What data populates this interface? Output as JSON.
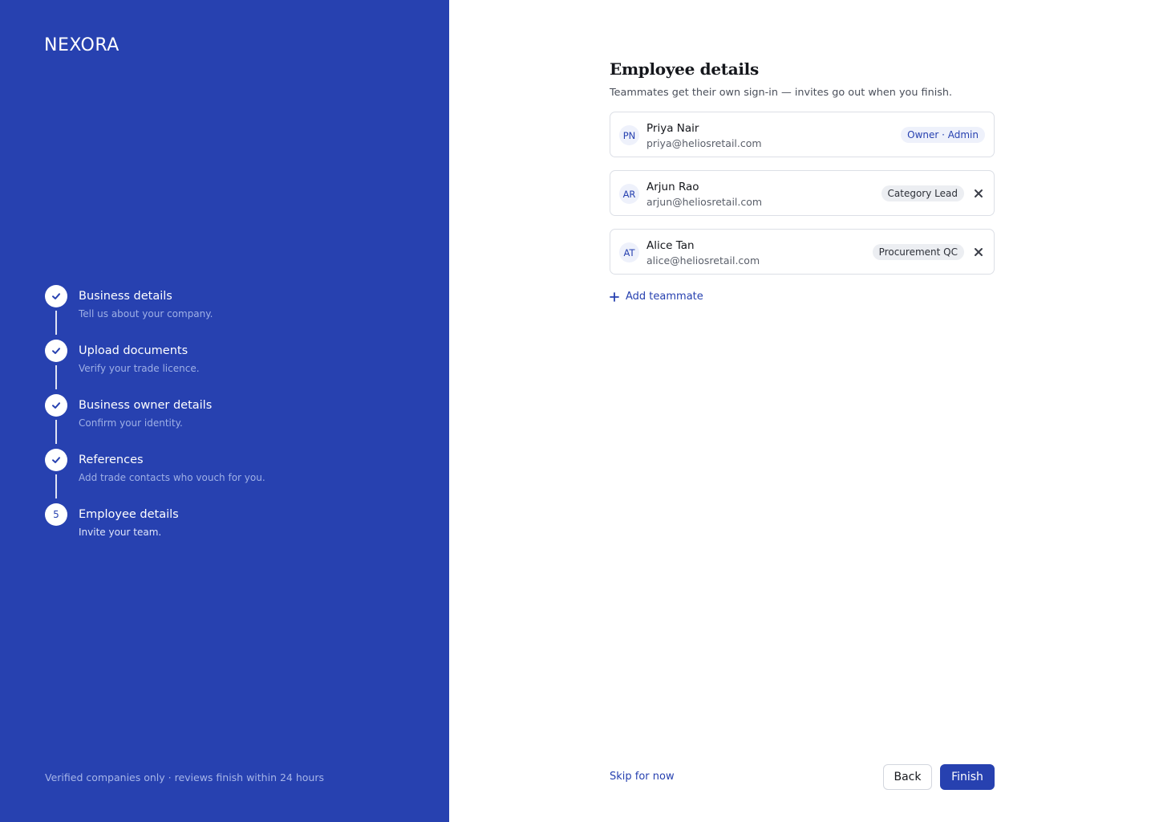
{
  "brand": {
    "logo": "NEXORA"
  },
  "steps": [
    {
      "title": "Business details",
      "subtitle": "Tell us about your company.",
      "status": "complete"
    },
    {
      "title": "Upload documents",
      "subtitle": "Verify your trade licence.",
      "status": "complete"
    },
    {
      "title": "Business owner details",
      "subtitle": "Confirm your identity.",
      "status": "complete"
    },
    {
      "title": "References",
      "subtitle": "Add trade contacts who vouch for you.",
      "status": "complete"
    },
    {
      "title": "Employee details",
      "subtitle": "Invite your team.",
      "status": "current",
      "number": "5"
    }
  ],
  "footer_note": "Verified companies only · reviews finish within 24 hours",
  "main": {
    "title": "Employee details",
    "description": "Teammates get their own sign-in — invites go out when you finish.",
    "teammates": [
      {
        "initials": "PN",
        "name": "Priya Nair",
        "email": "priya@heliosretail.com",
        "role": "Owner · Admin",
        "removable": false
      },
      {
        "initials": "AR",
        "name": "Arjun Rao",
        "email": "arjun@heliosretail.com",
        "role": "Category Lead",
        "removable": true
      },
      {
        "initials": "AT",
        "name": "Alice Tan",
        "email": "alice@heliosretail.com",
        "role": "Procurement QC",
        "removable": true
      }
    ],
    "add_label": "Add teammate"
  },
  "actions": {
    "skip": "Skip for now",
    "back": "Back",
    "finish": "Finish"
  },
  "colors": {
    "brand": "#2741b0",
    "panel": "#2741b0"
  },
  "icons": {
    "step_complete": "check-icon",
    "remove": "close-icon",
    "add": "plus-icon"
  }
}
